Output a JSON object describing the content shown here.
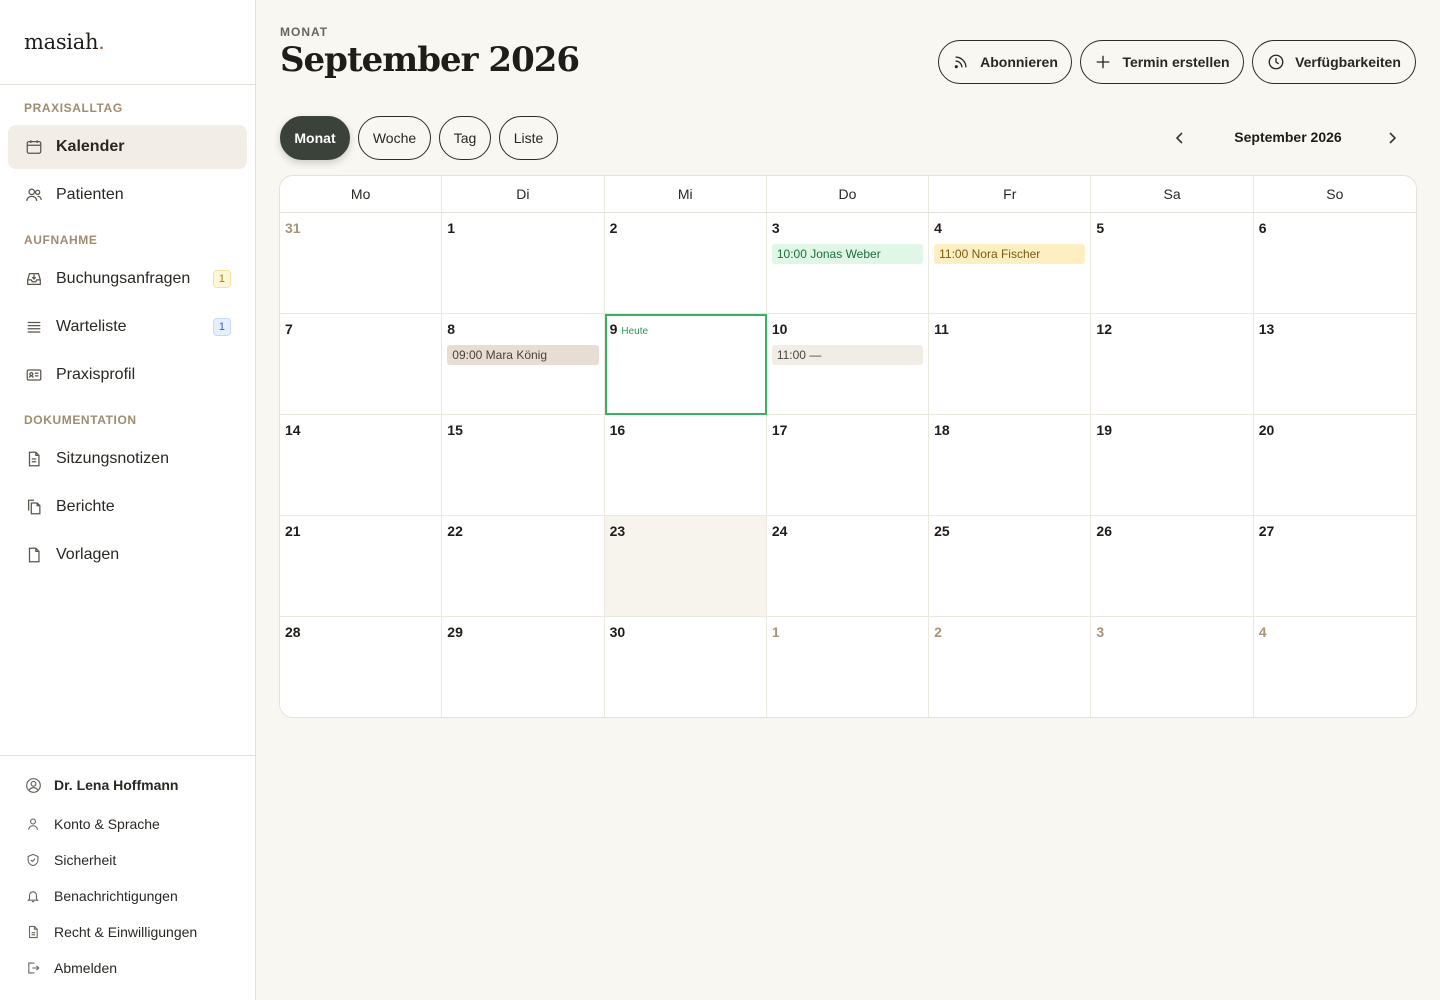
{
  "brand": {
    "name": "masiah",
    "dot": "."
  },
  "sidebar": {
    "sections": [
      {
        "label": "PRAXISALLTAG",
        "items": [
          {
            "label": "Kalender",
            "icon": "calendar-icon",
            "active": true
          },
          {
            "label": "Patienten",
            "icon": "users-icon"
          }
        ]
      },
      {
        "label": "AUFNAHME",
        "items": [
          {
            "label": "Buchungsanfragen",
            "icon": "inbox-icon",
            "badge": "1",
            "badge_color": "yellow"
          },
          {
            "label": "Warteliste",
            "icon": "list-icon",
            "badge": "1",
            "badge_color": "blue"
          },
          {
            "label": "Praxisprofil",
            "icon": "id-card-icon"
          }
        ]
      },
      {
        "label": "DOKUMENTATION",
        "items": [
          {
            "label": "Sitzungsnotizen",
            "icon": "note-icon"
          },
          {
            "label": "Berichte",
            "icon": "copy-icon"
          },
          {
            "label": "Vorlagen",
            "icon": "file-icon"
          }
        ]
      }
    ]
  },
  "footer": {
    "user": "Dr. Lena Hoffmann",
    "items": [
      {
        "label": "Konto & Sprache",
        "icon": "person-icon"
      },
      {
        "label": "Sicherheit",
        "icon": "shield-icon"
      },
      {
        "label": "Benachrichtigungen",
        "icon": "bell-icon"
      },
      {
        "label": "Recht & Einwilligungen",
        "icon": "document-icon"
      },
      {
        "label": "Abmelden",
        "icon": "logout-icon"
      }
    ]
  },
  "header": {
    "eyebrow": "MONAT",
    "title": "September 2026",
    "buttons": {
      "subscribe": "Abonnieren",
      "create": "Termin erstellen",
      "availability": "Verfügbarkeiten"
    }
  },
  "views": {
    "month": "Monat",
    "week": "Woche",
    "day": "Tag",
    "list": "Liste",
    "active": "month"
  },
  "nav": {
    "current": "September 2026"
  },
  "calendar": {
    "weekdays": [
      "Mo",
      "Di",
      "Mi",
      "Do",
      "Fr",
      "Sa",
      "So"
    ],
    "today_label": "Heute",
    "days": [
      {
        "n": "31",
        "muted": true
      },
      {
        "n": "1"
      },
      {
        "n": "2"
      },
      {
        "n": "3",
        "events": [
          {
            "text": "10:00 Jonas Weber",
            "color": "green"
          }
        ]
      },
      {
        "n": "4",
        "events": [
          {
            "text": "11:00 Nora Fischer",
            "color": "yellow"
          }
        ]
      },
      {
        "n": "5"
      },
      {
        "n": "6"
      },
      {
        "n": "7"
      },
      {
        "n": "8",
        "events": [
          {
            "text": "09:00 Mara König",
            "color": "brown"
          }
        ]
      },
      {
        "n": "9",
        "today": true
      },
      {
        "n": "10",
        "events": [
          {
            "text": "11:00 —",
            "color": "gray"
          }
        ]
      },
      {
        "n": "11"
      },
      {
        "n": "12"
      },
      {
        "n": "13"
      },
      {
        "n": "14"
      },
      {
        "n": "15"
      },
      {
        "n": "16"
      },
      {
        "n": "17"
      },
      {
        "n": "18"
      },
      {
        "n": "19"
      },
      {
        "n": "20"
      },
      {
        "n": "21"
      },
      {
        "n": "22"
      },
      {
        "n": "23",
        "shaded": true
      },
      {
        "n": "24"
      },
      {
        "n": "25"
      },
      {
        "n": "26"
      },
      {
        "n": "27"
      },
      {
        "n": "28"
      },
      {
        "n": "29"
      },
      {
        "n": "30"
      },
      {
        "n": "1",
        "muted": true
      },
      {
        "n": "2",
        "muted": true
      },
      {
        "n": "3",
        "muted": true
      },
      {
        "n": "4",
        "muted": true
      }
    ]
  },
  "colors": {
    "accent_dark": "#3a4239",
    "today_outline": "#3ab062",
    "brand_dot": "#c0582e",
    "section_label": "#a08c70"
  }
}
